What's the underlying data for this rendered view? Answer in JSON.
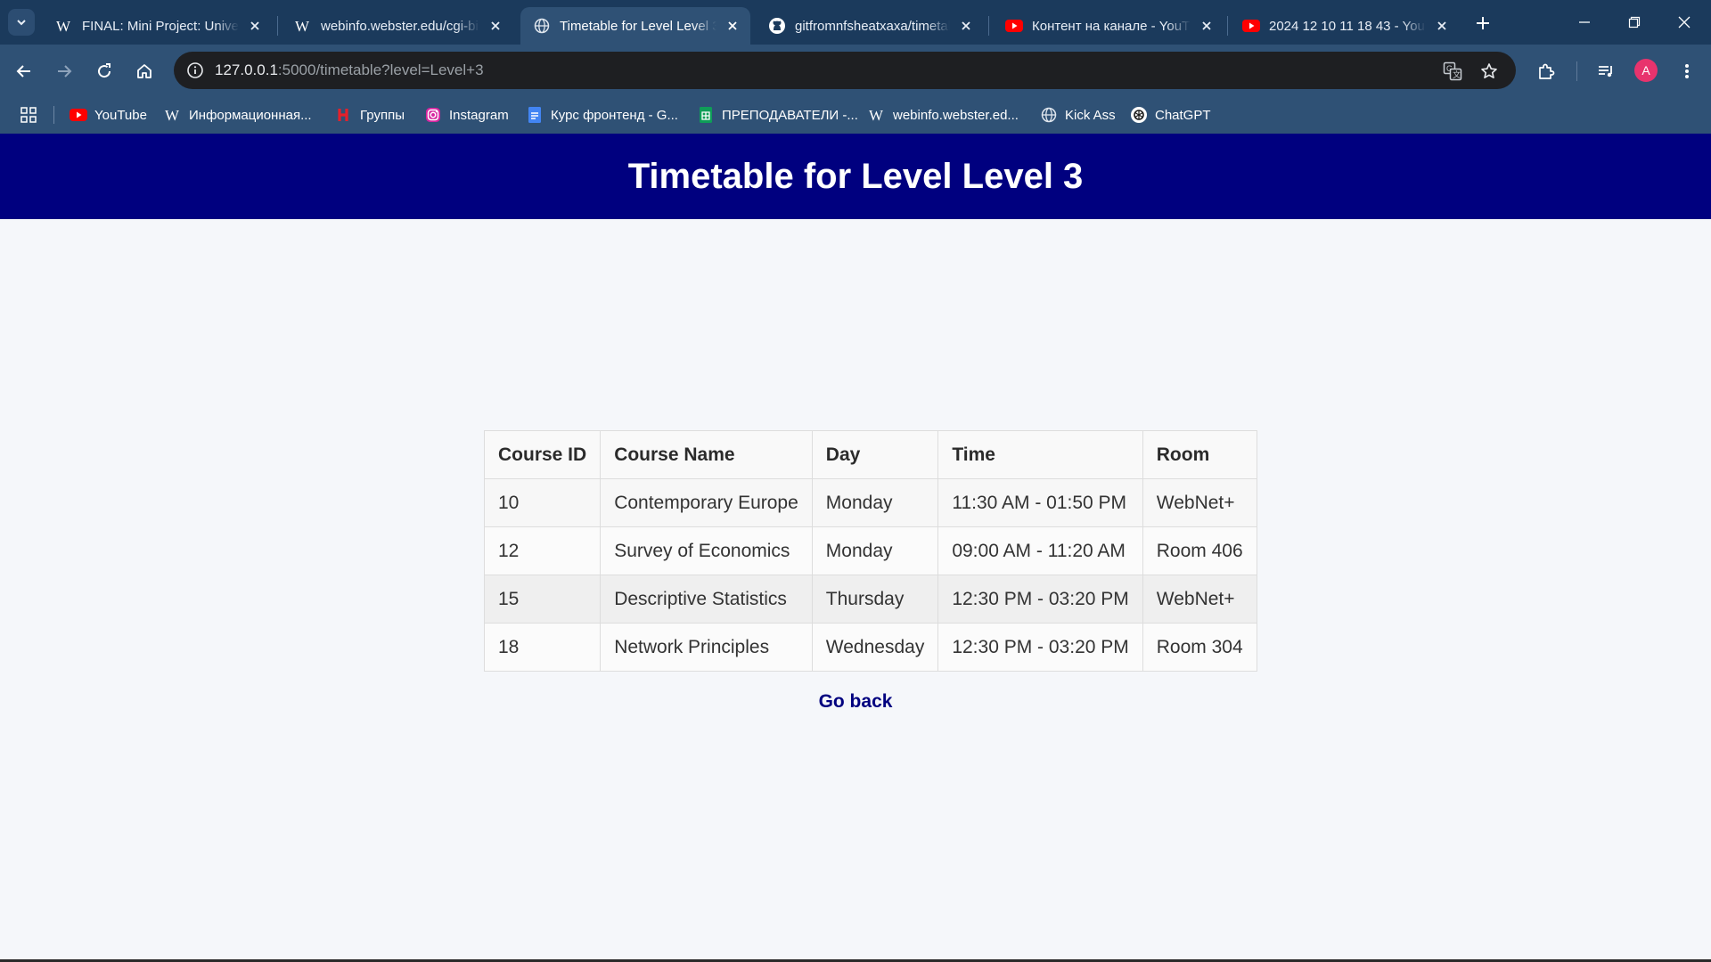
{
  "browser": {
    "tabs": [
      {
        "title": "FINAL: Mini Project: University",
        "icon": "wiki-w-icon",
        "active": false
      },
      {
        "title": "webinfo.webster.edu/cgi-bin",
        "icon": "wiki-w-icon",
        "active": false
      },
      {
        "title": "Timetable for Level Level 3",
        "icon": "globe-icon",
        "active": true
      },
      {
        "title": "gitfromnfsheatxaxa/timetable",
        "icon": "github-icon",
        "active": false
      },
      {
        "title": "Контент на канале - YouTube",
        "icon": "youtube-icon",
        "active": false
      },
      {
        "title": "2024 12 10 11 18 43 - YouTube",
        "icon": "youtube-icon",
        "active": false
      }
    ],
    "url_host": "127.0.0.1",
    "url_rest": ":5000/timetable?level=Level+3",
    "bookmarks": [
      {
        "label": "YouTube",
        "icon": "youtube-icon"
      },
      {
        "label": "Информационная...",
        "icon": "wiki-w-icon"
      },
      {
        "label": "Группы",
        "icon": "hh-icon"
      },
      {
        "label": "Instagram",
        "icon": "instagram-icon"
      },
      {
        "label": "Курс фронтенд - G...",
        "icon": "docs-icon"
      },
      {
        "label": "ПРЕПОДАВАТЕЛИ -...",
        "icon": "sheets-icon"
      },
      {
        "label": "webinfo.webster.ed...",
        "icon": "wiki-w-icon"
      },
      {
        "label": "Kick Ass",
        "icon": "globe-icon"
      },
      {
        "label": "ChatGPT",
        "icon": "chatgpt-icon"
      }
    ],
    "profile_initial": "A",
    "colors": {
      "frame": "#1b3a5c",
      "toolbar": "#2f5175",
      "omnibox": "#1e1f22",
      "avatar": "#e8336d"
    }
  },
  "page": {
    "header_title": "Timetable for Level Level 3",
    "header_color": "#00007f",
    "table": {
      "columns": [
        "Course ID",
        "Course Name",
        "Day",
        "Time",
        "Room"
      ],
      "rows": [
        [
          "10",
          "Contemporary Europe",
          "Monday",
          "11:30 AM - 01:50 PM",
          "WebNet+"
        ],
        [
          "12",
          "Survey of Economics",
          "Monday",
          "09:00 AM - 11:20 AM",
          "Room 406"
        ],
        [
          "15",
          "Descriptive Statistics",
          "Thursday",
          "12:30 PM - 03:20 PM",
          "WebNet+"
        ],
        [
          "18",
          "Network Principles",
          "Wednesday",
          "12:30 PM - 03:20 PM",
          "Room 304"
        ]
      ]
    },
    "go_back_label": "Go back"
  }
}
